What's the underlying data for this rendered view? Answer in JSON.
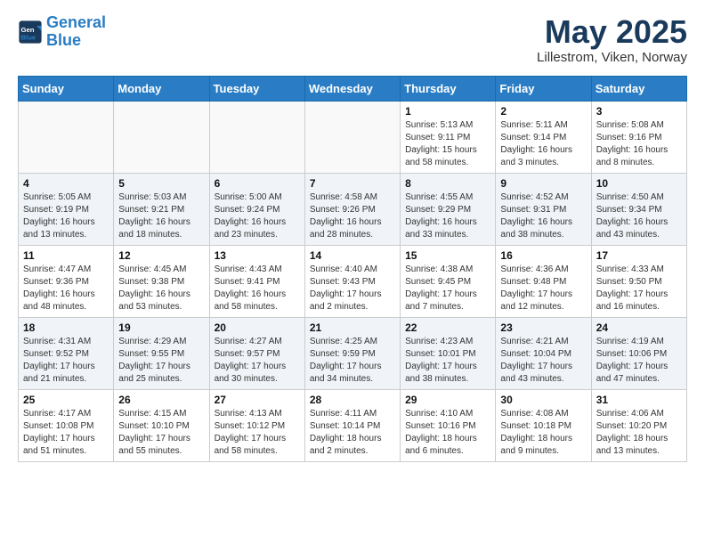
{
  "header": {
    "logo_line1": "General",
    "logo_line2": "Blue",
    "title": "May 2025",
    "subtitle": "Lillestrom, Viken, Norway"
  },
  "weekdays": [
    "Sunday",
    "Monday",
    "Tuesday",
    "Wednesday",
    "Thursday",
    "Friday",
    "Saturday"
  ],
  "weeks": [
    [
      {
        "day": "",
        "info": ""
      },
      {
        "day": "",
        "info": ""
      },
      {
        "day": "",
        "info": ""
      },
      {
        "day": "",
        "info": ""
      },
      {
        "day": "1",
        "info": "Sunrise: 5:13 AM\nSunset: 9:11 PM\nDaylight: 15 hours\nand 58 minutes."
      },
      {
        "day": "2",
        "info": "Sunrise: 5:11 AM\nSunset: 9:14 PM\nDaylight: 16 hours\nand 3 minutes."
      },
      {
        "day": "3",
        "info": "Sunrise: 5:08 AM\nSunset: 9:16 PM\nDaylight: 16 hours\nand 8 minutes."
      }
    ],
    [
      {
        "day": "4",
        "info": "Sunrise: 5:05 AM\nSunset: 9:19 PM\nDaylight: 16 hours\nand 13 minutes."
      },
      {
        "day": "5",
        "info": "Sunrise: 5:03 AM\nSunset: 9:21 PM\nDaylight: 16 hours\nand 18 minutes."
      },
      {
        "day": "6",
        "info": "Sunrise: 5:00 AM\nSunset: 9:24 PM\nDaylight: 16 hours\nand 23 minutes."
      },
      {
        "day": "7",
        "info": "Sunrise: 4:58 AM\nSunset: 9:26 PM\nDaylight: 16 hours\nand 28 minutes."
      },
      {
        "day": "8",
        "info": "Sunrise: 4:55 AM\nSunset: 9:29 PM\nDaylight: 16 hours\nand 33 minutes."
      },
      {
        "day": "9",
        "info": "Sunrise: 4:52 AM\nSunset: 9:31 PM\nDaylight: 16 hours\nand 38 minutes."
      },
      {
        "day": "10",
        "info": "Sunrise: 4:50 AM\nSunset: 9:34 PM\nDaylight: 16 hours\nand 43 minutes."
      }
    ],
    [
      {
        "day": "11",
        "info": "Sunrise: 4:47 AM\nSunset: 9:36 PM\nDaylight: 16 hours\nand 48 minutes."
      },
      {
        "day": "12",
        "info": "Sunrise: 4:45 AM\nSunset: 9:38 PM\nDaylight: 16 hours\nand 53 minutes."
      },
      {
        "day": "13",
        "info": "Sunrise: 4:43 AM\nSunset: 9:41 PM\nDaylight: 16 hours\nand 58 minutes."
      },
      {
        "day": "14",
        "info": "Sunrise: 4:40 AM\nSunset: 9:43 PM\nDaylight: 17 hours\nand 2 minutes."
      },
      {
        "day": "15",
        "info": "Sunrise: 4:38 AM\nSunset: 9:45 PM\nDaylight: 17 hours\nand 7 minutes."
      },
      {
        "day": "16",
        "info": "Sunrise: 4:36 AM\nSunset: 9:48 PM\nDaylight: 17 hours\nand 12 minutes."
      },
      {
        "day": "17",
        "info": "Sunrise: 4:33 AM\nSunset: 9:50 PM\nDaylight: 17 hours\nand 16 minutes."
      }
    ],
    [
      {
        "day": "18",
        "info": "Sunrise: 4:31 AM\nSunset: 9:52 PM\nDaylight: 17 hours\nand 21 minutes."
      },
      {
        "day": "19",
        "info": "Sunrise: 4:29 AM\nSunset: 9:55 PM\nDaylight: 17 hours\nand 25 minutes."
      },
      {
        "day": "20",
        "info": "Sunrise: 4:27 AM\nSunset: 9:57 PM\nDaylight: 17 hours\nand 30 minutes."
      },
      {
        "day": "21",
        "info": "Sunrise: 4:25 AM\nSunset: 9:59 PM\nDaylight: 17 hours\nand 34 minutes."
      },
      {
        "day": "22",
        "info": "Sunrise: 4:23 AM\nSunset: 10:01 PM\nDaylight: 17 hours\nand 38 minutes."
      },
      {
        "day": "23",
        "info": "Sunrise: 4:21 AM\nSunset: 10:04 PM\nDaylight: 17 hours\nand 43 minutes."
      },
      {
        "day": "24",
        "info": "Sunrise: 4:19 AM\nSunset: 10:06 PM\nDaylight: 17 hours\nand 47 minutes."
      }
    ],
    [
      {
        "day": "25",
        "info": "Sunrise: 4:17 AM\nSunset: 10:08 PM\nDaylight: 17 hours\nand 51 minutes."
      },
      {
        "day": "26",
        "info": "Sunrise: 4:15 AM\nSunset: 10:10 PM\nDaylight: 17 hours\nand 55 minutes."
      },
      {
        "day": "27",
        "info": "Sunrise: 4:13 AM\nSunset: 10:12 PM\nDaylight: 17 hours\nand 58 minutes."
      },
      {
        "day": "28",
        "info": "Sunrise: 4:11 AM\nSunset: 10:14 PM\nDaylight: 18 hours\nand 2 minutes."
      },
      {
        "day": "29",
        "info": "Sunrise: 4:10 AM\nSunset: 10:16 PM\nDaylight: 18 hours\nand 6 minutes."
      },
      {
        "day": "30",
        "info": "Sunrise: 4:08 AM\nSunset: 10:18 PM\nDaylight: 18 hours\nand 9 minutes."
      },
      {
        "day": "31",
        "info": "Sunrise: 4:06 AM\nSunset: 10:20 PM\nDaylight: 18 hours\nand 13 minutes."
      }
    ]
  ]
}
